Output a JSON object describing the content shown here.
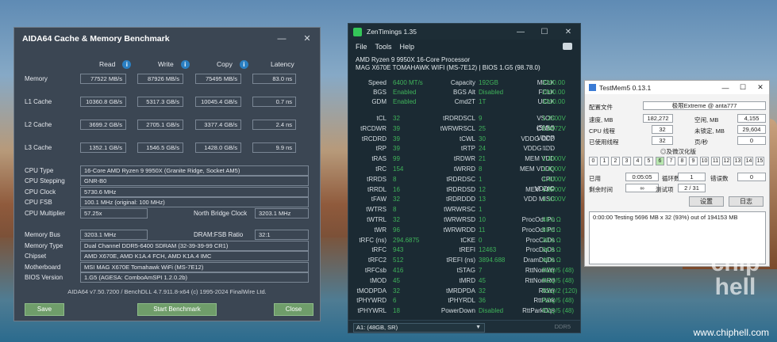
{
  "aida": {
    "title": "AIDA64 Cache & Memory Benchmark",
    "columns": [
      "Read",
      "Write",
      "Copy",
      "Latency"
    ],
    "rows": [
      {
        "label": "Memory",
        "read": "77522 MB/s",
        "write": "87926 MB/s",
        "copy": "75495 MB/s",
        "latency": "83.0 ns"
      },
      {
        "label": "L1 Cache",
        "read": "10360.8 GB/s",
        "write": "5317.3 GB/s",
        "copy": "10045.4 GB/s",
        "latency": "0.7 ns"
      },
      {
        "label": "L2 Cache",
        "read": "3699.2 GB/s",
        "write": "2705.1 GB/s",
        "copy": "3377.4 GB/s",
        "latency": "2.4 ns"
      },
      {
        "label": "L3 Cache",
        "read": "1352.1 GB/s",
        "write": "1546.5 GB/s",
        "copy": "1428.0 GB/s",
        "latency": "9.9 ns"
      }
    ],
    "cpu": {
      "type_label": "CPU Type",
      "type": "16-Core AMD Ryzen 9 9950X  (Granite Ridge, Socket AM5)",
      "stepping_label": "CPU Stepping",
      "stepping": "GNR-B0",
      "clock_label": "CPU Clock",
      "clock": "5730.6 MHz",
      "fsb_label": "CPU FSB",
      "fsb": "100.1 MHz  (original: 100 MHz)",
      "mult_label": "CPU Multiplier",
      "mult": "57.25x",
      "nb_label": "North Bridge Clock",
      "nb": "3203.1 MHz"
    },
    "mem": {
      "bus_label": "Memory Bus",
      "bus": "3203.1 MHz",
      "ratio_label": "DRAM:FSB Ratio",
      "ratio": "32:1",
      "type_label": "Memory Type",
      "type": "Dual Channel DDR5-6400 SDRAM  (32-39-39-99 CR1)",
      "chipset_label": "Chipset",
      "chipset": "AMD X670E, AMD K1A.4 FCH, AMD K1A.4 IMC",
      "mb_label": "Motherboard",
      "mb": "MSI MAG X670E Tomahawk WiFi (MS-7E12)",
      "bios_label": "BIOS Version",
      "bios": "1.G5  (AGESA: ComboAmSPI 1.2.0.2b)"
    },
    "footer": "AIDA64 v7.50.7200 / BenchDLL 4.7.911.8-x64  (c) 1995-2024 FinalWire Ltd.",
    "save": "Save",
    "start": "Start Benchmark",
    "close": "Close"
  },
  "zen": {
    "title": "ZenTimings 1.35",
    "menu": [
      "File",
      "Tools",
      "Help"
    ],
    "cpu": "AMD Ryzen 9 9950X 16-Core Processor",
    "board": "MAG X670E TOMAHAWK WIFI (MS-7E12) | BIOS 1.G5 (98.78.0)",
    "top": [
      [
        "Speed",
        "6400 MT/s",
        "Capacity",
        "192GB",
        "MCLK",
        "3200.00"
      ],
      [
        "BGS",
        "Enabled",
        "BGS Alt",
        "Disabled",
        "FCLK",
        "2000.00"
      ],
      [
        "GDM",
        "Enabled",
        "Cmd2T",
        "1T",
        "UCLK",
        "3200.00"
      ]
    ],
    "rows": [
      [
        "tCL",
        "32",
        "tRDRDSCL",
        "9",
        "VSOC (SMU)",
        "1.2500V"
      ],
      [
        "tRCDWR",
        "39",
        "tWRWRSCL",
        "25",
        "CLDO VDDP",
        "0.9472V"
      ],
      [
        "tRCDRD",
        "39",
        "tCWL",
        "30",
        "VDDG CCD",
        "N/A"
      ],
      [
        "tRP",
        "39",
        "tRTP",
        "24",
        "VDDG IOD",
        "N/A"
      ],
      [
        "tRAS",
        "99",
        "tRDWR",
        "21",
        "MEM VDD",
        "1.4000V"
      ],
      [
        "tRC",
        "154",
        "tWRRD",
        "8",
        "MEM VDDQ",
        "1.4000V"
      ],
      [
        "tRRDS",
        "8",
        "tRDRDSC",
        "1",
        "CPU VDDIO",
        "1.4000V"
      ],
      [
        "tRRDL",
        "16",
        "tRDRDSD",
        "12",
        "MEM VPP",
        "1.8000V"
      ],
      [
        "tFAW",
        "32",
        "tRDRDDD",
        "13",
        "VDD MISC",
        "1.1000V"
      ],
      [
        "tWTRS",
        "8",
        "tWRWRSC",
        "1",
        "",
        ""
      ],
      [
        "tWTRL",
        "32",
        "tWRWRSD",
        "10",
        "ProcOdt Pu",
        "48.0 Ω"
      ],
      [
        "tWR",
        "96",
        "tWRWRDD",
        "11",
        "ProcOdt Pd",
        "60.0 Ω"
      ],
      [
        "tRFC (ns)",
        "294.6875",
        "tCKE",
        "0",
        "ProcCaDs",
        "30.0 Ω"
      ],
      [
        "tRFC",
        "943",
        "tREFI",
        "12463",
        "ProcDqDs",
        "34.3 Ω"
      ],
      [
        "tRFC2",
        "512",
        "tREFI (ns)",
        "3894.688",
        "DramDqDs",
        "40.0 Ω"
      ],
      [
        "tRFCsb",
        "416",
        "tSTAG",
        "7",
        "RttNomWr",
        "RZQ/5 (48)"
      ],
      [
        "tMOD",
        "45",
        "tMRD",
        "45",
        "RttNomRd",
        "RZQ/5 (48)"
      ],
      [
        "tMODPDA",
        "32",
        "tMRDPDA",
        "32",
        "RttWr",
        "RZQ/2 (120)"
      ],
      [
        "tPHYWRD",
        "6",
        "tPHYRDL",
        "36",
        "RttPark",
        "RZQ/5 (48)"
      ],
      [
        "tPHYWRL",
        "18",
        "PowerDown",
        "Disabled",
        "RttParkDqs",
        "RZQ/5 (48)"
      ]
    ],
    "dimm": "A1: (48GB, SR)",
    "ddr": "DDR5",
    "accent": "#3fb35a"
  },
  "tm": {
    "title": "TestMem5  0.13.1",
    "cfg_label": "配置文件",
    "cfg": "极限Extreme @ anta777",
    "speed_label": "速度, MB",
    "speed": "182,272",
    "free_label": "空闲, MB",
    "free": "4,155",
    "threads_label": "CPU 线程",
    "threads": "32",
    "unlocked_label": "未锁定, MB",
    "unlocked": "29,604",
    "used_label": "已使用线程",
    "used": "32",
    "pages_label": "页/秒",
    "pages": "0",
    "section": "◎及微汉化版",
    "nums": [
      "0",
      "1",
      "2",
      "3",
      "4",
      "5",
      "6",
      "7",
      "8",
      "9",
      "10",
      "11",
      "12",
      "13",
      "14",
      "15"
    ],
    "active": "6",
    "time_label": "已用",
    "time": "0:05:05",
    "cycle_label": "循环数",
    "cycle": "1",
    "err_label": "错误数",
    "err": "0",
    "remain_label": "剩余时间",
    "remain": "∞",
    "test_label": "测试项",
    "test": "2 / 31",
    "settings": "设置",
    "log": "日志",
    "logline": "0:00:00   Testing 5696 MB x 32 (93%) out of 194153 MB"
  },
  "watermark": {
    "text": "chip hell",
    "url": "www.chiphell.com"
  }
}
